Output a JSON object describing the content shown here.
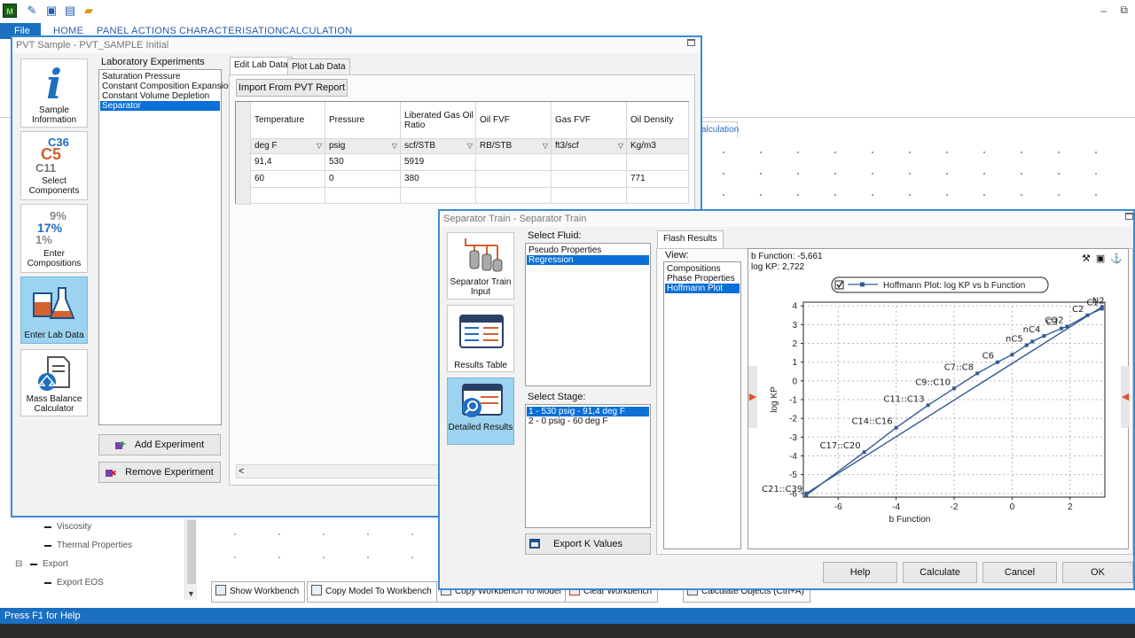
{
  "app": {
    "logo_text": "M",
    "menu": {
      "file": "File",
      "tabs": [
        "HOME",
        "PANEL ACTIONS",
        "CHARACTERISATION",
        "CALCULATION"
      ]
    },
    "background_tab": "alculation",
    "status": "Press F1 for Help",
    "icons": [
      "new-file-icon",
      "save-icon",
      "save-as-icon",
      "open-folder-icon"
    ]
  },
  "tree": {
    "items": [
      {
        "label": "Viscosity",
        "level": 2
      },
      {
        "label": "Thermal Properties",
        "level": 2
      },
      {
        "label": "Export",
        "level": 1
      },
      {
        "label": "Export EOS",
        "level": 2
      }
    ],
    "collapse_glyph": "⊟"
  },
  "workbench_buttons": [
    "Show Workbench",
    "Copy Model To Workbench",
    "Copy Workbench To Model",
    "Clear Workbench",
    "Calculate Objects (Ctrl+A)"
  ],
  "pvt_dialog": {
    "title": "PVT Sample - PVT_SAMPLE Initial",
    "tiles": [
      {
        "label": "Sample Information"
      },
      {
        "label": "Select Components",
        "graphic": [
          "C36",
          "C5",
          "C11"
        ]
      },
      {
        "label": "Enter Compositions",
        "graphic": [
          "9%",
          "17%",
          "1%"
        ]
      },
      {
        "label": "Enter Lab Data",
        "selected": true
      },
      {
        "label": "Mass Balance Calculator"
      }
    ],
    "experiments_label": "Laboratory Experiments",
    "experiments": [
      "Saturation Pressure",
      "Constant Composition Expansion",
      "Constant Volume Depletion",
      "Separator"
    ],
    "selected_experiment": "Separator",
    "add_button": "Add Experiment",
    "remove_button": "Remove Experiment",
    "tabs": [
      "Edit Lab Data",
      "Plot Lab Data"
    ],
    "active_tab": "Edit Lab Data",
    "import_button": "Import From PVT Report",
    "grid": {
      "headers": [
        "Temperature",
        "Pressure",
        "Liberated Gas Oil Ratio",
        "Oil FVF",
        "Gas FVF",
        "Oil Density"
      ],
      "units": [
        "deg F",
        "psig",
        "scf/STB",
        "RB/STB",
        "ft3/scf",
        "Kg/m3"
      ],
      "rows": [
        [
          "91,4",
          "530",
          "5919",
          "",
          "",
          ""
        ],
        [
          "60",
          "0",
          "380",
          "",
          "",
          "771"
        ],
        [
          "",
          "",
          "",
          "",
          "",
          ""
        ]
      ]
    },
    "scroll_left": "<"
  },
  "sep_dialog": {
    "title": "Separator Train - Separator Train",
    "tiles": [
      {
        "label": "Separator Train Input"
      },
      {
        "label": "Results Table"
      },
      {
        "label": "Detailed Results",
        "selected": true
      }
    ],
    "select_fluid_label": "Select Fluid:",
    "fluids": [
      "Pseudo Properties",
      "Regression"
    ],
    "selected_fluid": "Regression",
    "select_stage_label": "Select Stage:",
    "stages": [
      "1 - 530 psig - 91,4 deg F",
      "2 - 0 psig - 60 deg F"
    ],
    "selected_stage": "1 - 530 psig - 91,4 deg F",
    "export_button": "Export K Values",
    "results_tab": "Flash Results",
    "view_label": "View:",
    "views": [
      "Compositions",
      "Phase Properties",
      "Hoffmann Plot"
    ],
    "selected_view": "Hoffmann Plot",
    "buttons": [
      "Help",
      "Calculate",
      "Cancel",
      "OK"
    ]
  },
  "chart_data": {
    "type": "line",
    "title": "",
    "readout": [
      "b Function: -5,661",
      "log KP: 2,722"
    ],
    "legend": "Hoffmann Plot: log KP vs b Function",
    "legend_placement": "top-center",
    "xlabel": "b Function",
    "ylabel": "log KP",
    "xlim": [
      -7.2,
      3.2
    ],
    "ylim": [
      -6.2,
      4.2
    ],
    "xticks": [
      -6,
      -4,
      -2,
      0,
      2
    ],
    "yticks": [
      4,
      3,
      2,
      1,
      0,
      -1,
      -2,
      -3,
      -4,
      -5,
      -6
    ],
    "grid": true,
    "series": [
      {
        "x": [
          -7.1,
          -5.1,
          -4.0,
          -2.9,
          -2.0,
          -1.2,
          -0.5,
          0.0,
          0.5,
          0.7,
          1.1,
          1.7,
          1.9,
          2.6,
          3.1
        ],
        "y": [
          -6.1,
          -3.8,
          -2.5,
          -1.3,
          -0.4,
          0.4,
          1.0,
          1.4,
          1.9,
          2.1,
          2.4,
          2.8,
          2.9,
          3.5,
          3.85
        ],
        "labels": [
          "C21::C39",
          "C17::C20",
          "C14::C16",
          "C11::C13",
          "C9::C10",
          "C7::C8",
          "C6",
          "",
          "nC5",
          "",
          "nC4",
          "C3",
          "CO2",
          "C2",
          "C1"
        ]
      },
      {
        "x": [
          -7.1,
          3.1
        ],
        "y": [
          -6.0,
          3.95
        ],
        "labels": [
          "",
          "N2"
        ]
      }
    ]
  }
}
